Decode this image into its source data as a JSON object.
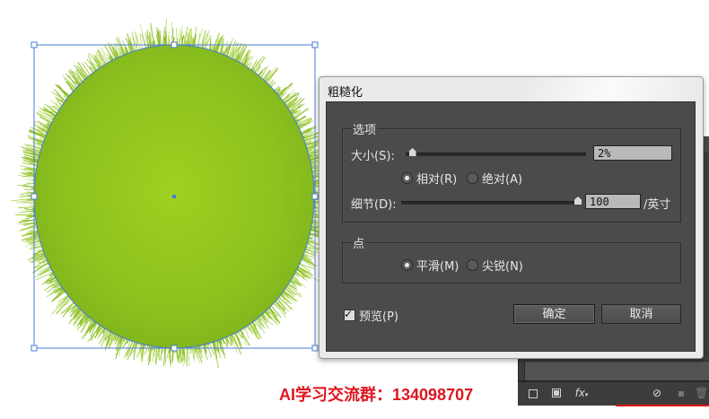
{
  "dialog": {
    "title": "粗糙化",
    "options_group": {
      "title": "选项",
      "size": {
        "label": "大小(S):",
        "value": "2%",
        "level_percent": 2
      },
      "mode": {
        "relative_label": "相对(R)",
        "absolute_label": "绝对(A)",
        "selected": "relative"
      },
      "detail": {
        "label": "细节(D):",
        "value": "100",
        "unit": "/英寸",
        "level_percent": 100
      }
    },
    "points_group": {
      "title": "点",
      "smooth_label": "平滑(M)",
      "corner_label": "尖锐(N)",
      "selected": "smooth"
    },
    "preview": {
      "label": "预览(P)",
      "checked": true
    },
    "ok_label": "确定",
    "cancel_label": "取消"
  },
  "toolbar": {
    "fx_label": "fx"
  },
  "watermark": "AI学习交流群：134098707",
  "colors": {
    "shape_green": "#8fc31f",
    "shape_green_light": "#a6d22a",
    "selection_blue": "#4a7bd6",
    "dialog_bg": "#4b4b4b",
    "watermark_red": "#e0141e"
  },
  "icons": [
    "new-layer-icon",
    "mask-icon",
    "fx-icon",
    "no-entry-icon",
    "duplicate-icon",
    "trash-icon",
    "checkmark-icon",
    "slider-thumb-icon"
  ]
}
